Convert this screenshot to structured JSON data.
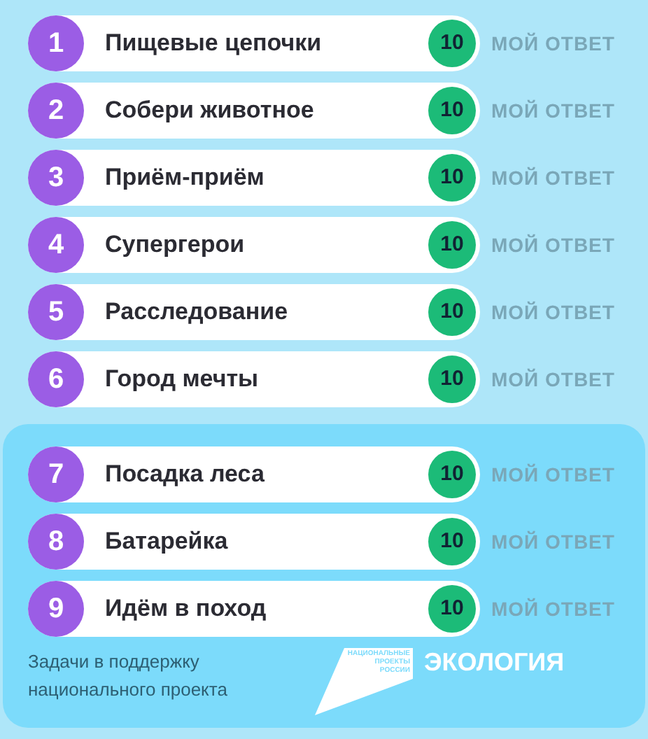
{
  "sections": [
    {
      "kind": "plain",
      "tasks": [
        {
          "number": "1",
          "title": "Пищевые цепочки",
          "score": "10",
          "answer_link": "МОЙ ОТВЕТ"
        },
        {
          "number": "2",
          "title": "Собери животное",
          "score": "10",
          "answer_link": "МОЙ ОТВЕТ"
        },
        {
          "number": "3",
          "title": "Приём-приём",
          "score": "10",
          "answer_link": "МОЙ ОТВЕТ"
        },
        {
          "number": "4",
          "title": "Супергерои",
          "score": "10",
          "answer_link": "МОЙ ОТВЕТ"
        },
        {
          "number": "5",
          "title": "Расследование",
          "score": "10",
          "answer_link": "МОЙ ОТВЕТ"
        },
        {
          "number": "6",
          "title": "Город мечты",
          "score": "10",
          "answer_link": "МОЙ ОТВЕТ"
        }
      ]
    },
    {
      "kind": "panel",
      "tasks": [
        {
          "number": "7",
          "title": "Посадка леса",
          "score": "10",
          "answer_link": "МОЙ ОТВЕТ"
        },
        {
          "number": "8",
          "title": "Батарейка",
          "score": "10",
          "answer_link": "МОЙ ОТВЕТ"
        },
        {
          "number": "9",
          "title": "Идём в поход",
          "score": "10",
          "answer_link": "МОЙ ОТВЕТ"
        }
      ],
      "footer": {
        "caption": "Задачи в поддержку национального проекта",
        "logo_lines": [
          "НАЦИОНАЛЬНЫЕ",
          "ПРОЕКТЫ",
          "РОССИИ"
        ],
        "project": "ЭКОЛОГИЯ"
      }
    }
  ]
}
